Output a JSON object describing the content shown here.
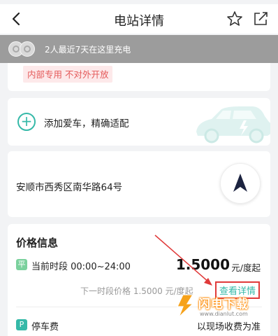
{
  "header": {
    "title": "电站详情"
  },
  "banner": {
    "text": "2人最近7天在这里充电"
  },
  "tag": {
    "label": "内部专用 不对外开放"
  },
  "car": {
    "label": "添加爱车，精确适配"
  },
  "address": {
    "text": "安顺市西秀区南华路64号"
  },
  "price": {
    "title": "价格信息",
    "current_badge": "平",
    "current_period": "当前时段 00:00~24:00",
    "current_price": "1.5000",
    "current_unit": "元/度起",
    "next_text": "下一时段价格 1.5000 元/度起",
    "detail_link": "查看详情"
  },
  "parking": {
    "badge": "P",
    "label": "停车费",
    "note": "以现场收费为准"
  },
  "watermark": {
    "text": "闪电下载",
    "url": "www.dianlut.com"
  },
  "colors": {
    "accent": "#35b9a8",
    "tag_text": "#e45a5a",
    "tag_bg": "#fde9ea",
    "banner_bg": "#9c9c9c",
    "highlight": "#e03a3a"
  }
}
